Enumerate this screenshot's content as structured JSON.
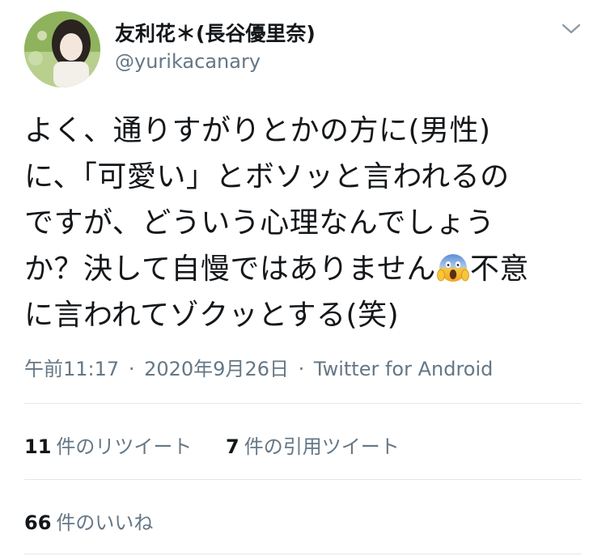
{
  "author": {
    "display_name": "友利花＊(長谷優里奈)",
    "handle": "@yurikacanary"
  },
  "tweet": {
    "line1": "よく、通りすがりとかの方に(男性)",
    "line2": "に、「可愛い」とボソッと言われるの",
    "line3": "ですが、どういう心理なんでしょう",
    "line4a": "か？決して自慢ではありません",
    "line4b": "不意",
    "line5": "に言われてゾクッとする(笑)",
    "emoji": "face-screaming-in-fear"
  },
  "meta": {
    "time": "午前11:17",
    "separator": "·",
    "date": "2020年9月26日",
    "source": "Twitter for Android"
  },
  "stats": {
    "retweets_count": "11",
    "retweets_label": "件のリツイート",
    "quotes_count": "7",
    "quotes_label": "件の引用ツイート",
    "likes_count": "66",
    "likes_label": "件のいいね"
  },
  "colors": {
    "text": "#14171a",
    "secondary": "#657786",
    "divider": "#e1e8ed"
  }
}
